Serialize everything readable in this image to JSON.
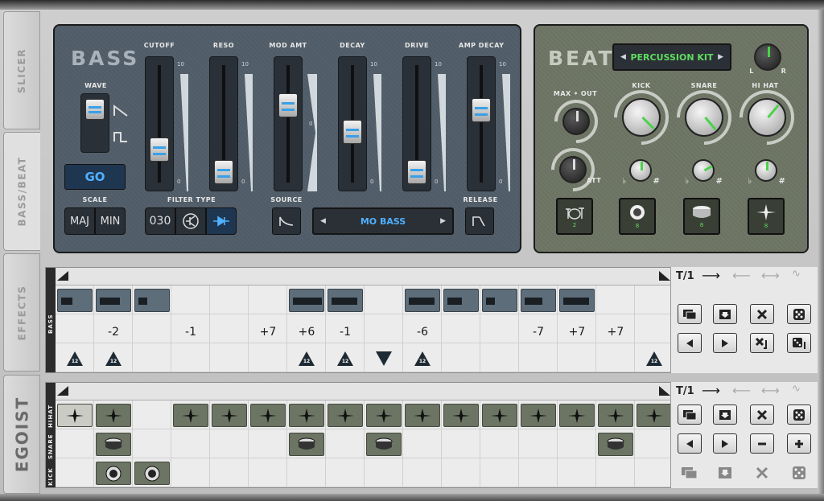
{
  "side_tabs": [
    "SLICER",
    "BASS/BEAT",
    "EFFECTS",
    "EGOIST"
  ],
  "bass": {
    "title": "BASS",
    "wave_label": "WAVE",
    "go_label": "GO",
    "scale_label": "SCALE",
    "scale_options": [
      "MAJ",
      "MIN"
    ],
    "filter_type_label": "FILTER TYPE",
    "filter_303": "030",
    "source_label": "SOURCE",
    "release_label": "RELEASE",
    "mod_source": "MO BASS",
    "faders": [
      {
        "label": "CUTOFF",
        "value": 0.3,
        "scale_top": "10",
        "scale_bottom": "0"
      },
      {
        "label": "RESO",
        "value": 0.08,
        "scale_top": "10",
        "scale_bottom": "0"
      },
      {
        "label": "MOD AMT",
        "value": 0.73,
        "scale_top": "",
        "scale_mid": "0",
        "scale_bottom": ""
      },
      {
        "label": "DECAY",
        "value": 0.47,
        "scale_top": "10",
        "scale_bottom": "0"
      },
      {
        "label": "DRIVE",
        "value": 0.08,
        "scale_top": "10",
        "scale_bottom": "0"
      },
      {
        "label": "AMP DECAY",
        "value": 0.68,
        "scale_top": "10",
        "scale_bottom": "0"
      }
    ]
  },
  "beat": {
    "title": "BEAT",
    "kit": "PERCUSSION KIT",
    "pan_l": "L",
    "pan_r": "R",
    "max_out_label": "MAX • OUT",
    "att_label": "ATT",
    "kick_label": "KICK",
    "snare_label": "SNARE",
    "hihat_label": "HI HAT",
    "flat": "♭",
    "sharp": "#",
    "pads": [
      "2",
      "8",
      "8",
      "8"
    ]
  },
  "bass_seq": {
    "row_label": "BASS",
    "tempo": "T/1",
    "semitones": [
      "",
      "-2",
      "",
      "-1",
      "",
      "+7",
      "+6",
      "-1",
      "",
      "-6",
      "",
      "",
      "-7",
      "+7",
      "+7",
      ""
    ],
    "octaves": [
      "12",
      "12",
      "",
      "",
      "",
      "",
      "12",
      "12",
      "",
      "12",
      "",
      "",
      "",
      "",
      "",
      "12"
    ]
  },
  "beat_seq": {
    "row_labels": [
      "HIHAT",
      "SNARE",
      "KICK"
    ],
    "tempo": "T/1"
  },
  "colors": {
    "accent_blue": "#3aa0e8",
    "accent_green": "#4ad24a",
    "bass_panel": "#4f5b66",
    "beat_panel": "#6b7262"
  }
}
